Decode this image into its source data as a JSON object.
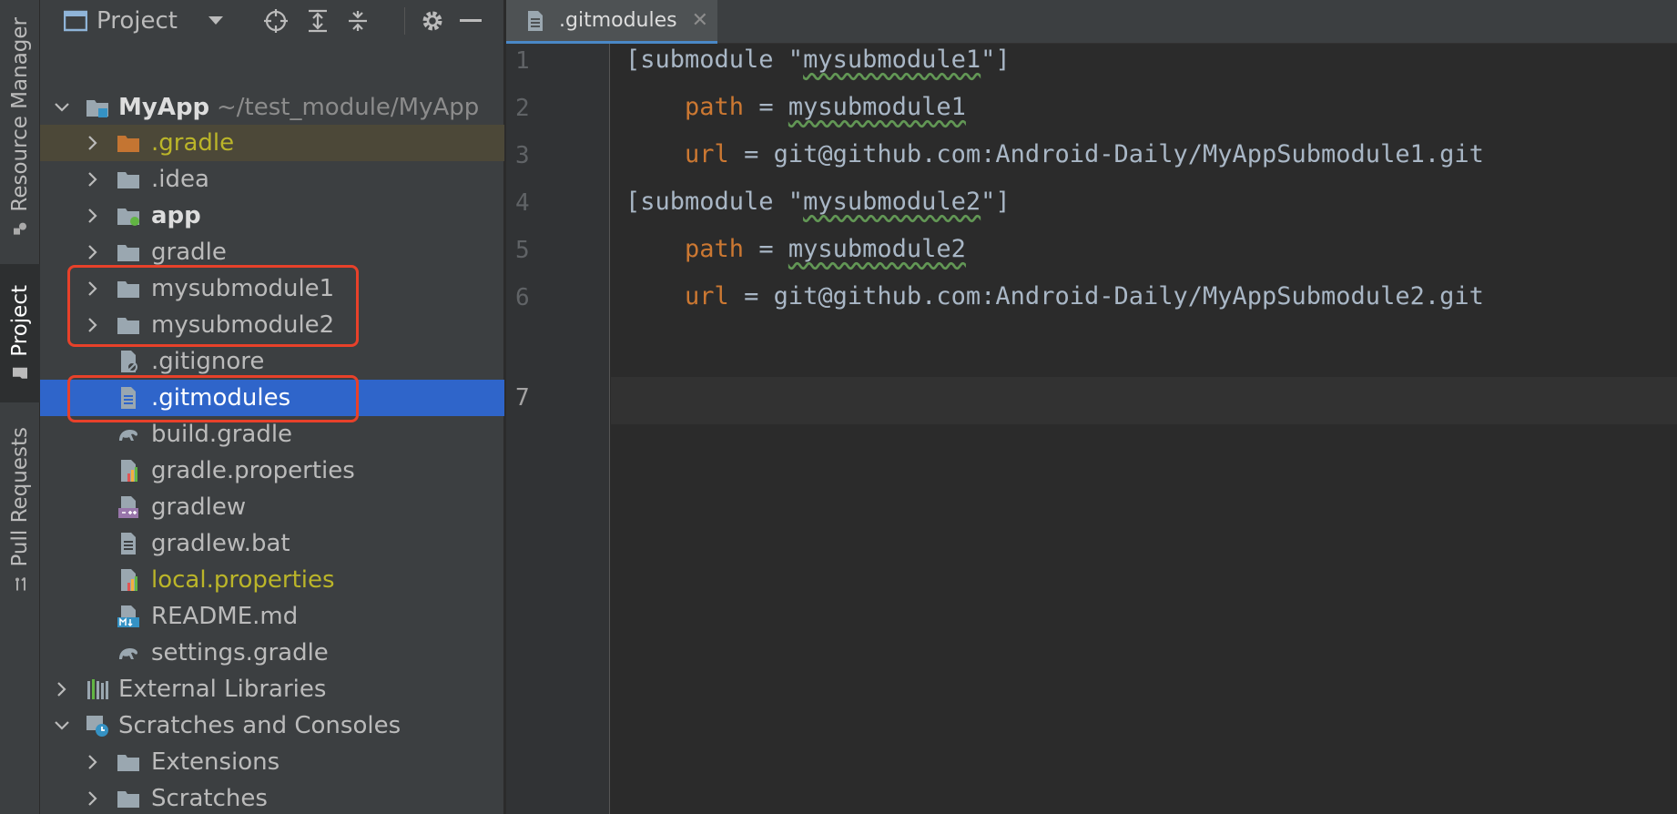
{
  "side_tabs": [
    {
      "label": "Resource Manager",
      "icon": "resource-manager-icon"
    },
    {
      "label": "Project",
      "icon": "folder-icon",
      "active": true
    },
    {
      "label": "Pull Requests",
      "icon": "pull-request-icon"
    }
  ],
  "project_panel": {
    "title": "Project",
    "tree": {
      "root": {
        "name": "MyApp",
        "path": "~/test_module/MyApp"
      },
      "items": [
        {
          "name": ".gradle"
        },
        {
          "name": ".idea"
        },
        {
          "name": "app"
        },
        {
          "name": "gradle"
        },
        {
          "name": "mysubmodule1"
        },
        {
          "name": "mysubmodule2"
        },
        {
          "name": ".gitignore"
        },
        {
          "name": ".gitmodules"
        },
        {
          "name": "build.gradle"
        },
        {
          "name": "gradle.properties"
        },
        {
          "name": "gradlew"
        },
        {
          "name": "gradlew.bat"
        },
        {
          "name": "local.properties"
        },
        {
          "name": "README.md"
        },
        {
          "name": "settings.gradle"
        }
      ],
      "external_libraries": "External Libraries",
      "scratches": {
        "name": "Scratches and Consoles",
        "children": [
          "Extensions",
          "Scratches"
        ]
      }
    }
  },
  "editor": {
    "tab": {
      "label": ".gitmodules"
    },
    "line_numbers": [
      "1",
      "2",
      "3",
      "4",
      "5",
      "6",
      "7"
    ],
    "lines": {
      "l1": {
        "open": "[submodule \"",
        "name": "mysubmodule1",
        "close": "\"]"
      },
      "l2": {
        "key": "path",
        "eq": " = ",
        "value": "mysubmodule1"
      },
      "l3": {
        "key": "url",
        "eq": " = ",
        "value": "git@github.com:Android-Daily/MyAppSubmodule1.git"
      },
      "l4": {
        "open": "[submodule \"",
        "name": "mysubmodule2",
        "close": "\"]"
      },
      "l5": {
        "key": "path",
        "eq": " = ",
        "value": "mysubmodule2"
      },
      "l6": {
        "key": "url",
        "eq": " = ",
        "value": "git@github.com:Android-Daily/MyAppSubmodule2.git"
      }
    }
  },
  "colors": {
    "selection": "#2f65ca",
    "highlight_box": "#e8412a",
    "keyword": "#cc7832",
    "ignored_file": "#bbb529"
  }
}
